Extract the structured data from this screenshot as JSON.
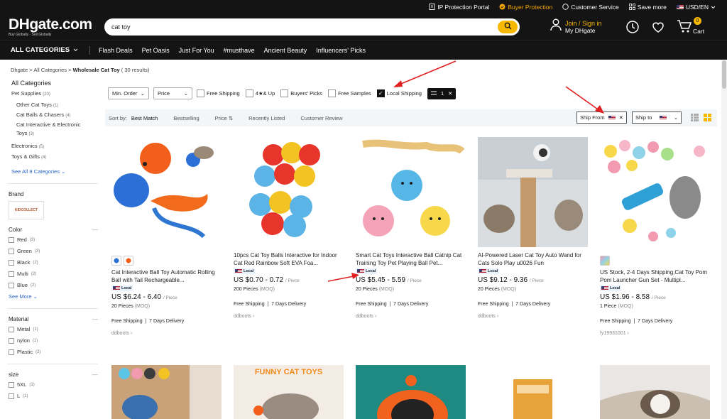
{
  "topbar": {
    "ip": "IP Protection Portal",
    "buyer": "Buyer Protection",
    "service": "Customer Service",
    "save": "Save more",
    "lang": "USD/EN"
  },
  "header": {
    "logo": "DHgate.com",
    "logo_tagline": "Buy Globally · Sell Globally",
    "search_value": "cat toy",
    "join": "Join / Sign in",
    "my": "My DHgate",
    "cart_count": "0",
    "cart": "Cart"
  },
  "nav": {
    "all_categories": "ALL CATEGORIES",
    "items": [
      "Flash Deals",
      "Pet Oasis",
      "Just For You",
      "#musthave",
      "Ancient Beauty",
      "Influencers' Picks"
    ]
  },
  "breadcrumb": {
    "a": "Dhgate",
    "sep1": " > ",
    "b": "All Categories",
    "sep2": " > ",
    "c": "Wholesale Cat Toy",
    "count_prefix": " ( ",
    "count": "30",
    "count_suffix": "  results)"
  },
  "sidebar": {
    "all_categories": "All Categories",
    "pet_supplies": "Pet Supplies",
    "pet_supplies_count": "(20)",
    "other_cat_toys": "Other Cat Toys",
    "other_cat_toys_count": "(1)",
    "cat_balls": "Cat Balls & Chasers",
    "cat_balls_count": "(4)",
    "cat_interactive": "Cat Interactive & Electronic Toys",
    "cat_interactive_count": "(3)",
    "electronics": "Electronics",
    "electronics_count": "(5)",
    "toys_gifts": "Toys & Gifts",
    "toys_gifts_count": "(4)",
    "see_all": "See All 8 Categories",
    "brand": "Brand",
    "brand_logo": "KIDCOLLECT",
    "color": "Color",
    "colors": [
      {
        "label": "Red",
        "count": "(3)"
      },
      {
        "label": "Green",
        "count": "(3)"
      },
      {
        "label": "Black",
        "count": "(2)"
      },
      {
        "label": "Multi",
        "count": "(2)"
      },
      {
        "label": "Blue",
        "count": "(2)"
      }
    ],
    "see_more": "See More",
    "material": "Material",
    "materials": [
      {
        "label": "Metal",
        "count": "(1)"
      },
      {
        "label": "nylon",
        "count": "(1)"
      },
      {
        "label": "Plastic",
        "count": "(2)"
      }
    ],
    "size": "size",
    "sizes": [
      {
        "label": "5XL",
        "count": "(1)"
      },
      {
        "label": "L",
        "count": "(1)"
      }
    ]
  },
  "filters": {
    "min_order": "Min. Order",
    "price": "Price",
    "free_shipping": "Free Shipping",
    "star_up": "4★& Up",
    "buyers_picks": "Buyers' Picks",
    "free_samples": "Free Samples",
    "local_shipping": "Local Shipping",
    "local_shipping_checked": true,
    "chip_count": "1"
  },
  "sort": {
    "label": "Sort by:",
    "best": "Best Match",
    "bestselling": "Bestselling",
    "price": "Price ⇅",
    "recent": "Recently Listed",
    "review": "Customer Review",
    "ship_from": "Ship From",
    "ship_to": "Ship to"
  },
  "products": [
    {
      "title": "Cat Interactive Ball Toy Automatic Rolling Ball with Tail Rechargeable...",
      "badge": "Local",
      "price": "US $6.24 - 6.40",
      "unit": "/ Piece",
      "moq": "20 Pieces",
      "moq_label": "(MOQ)",
      "ship": "Free Shipping  |  7 Days Delivery",
      "store": "ddboots"
    },
    {
      "title": "10pcs Cat Toy Balls Interactive for Indoor Cat Red Rainbow Soft EVA Foa...",
      "badge": "Local",
      "price": "US $0.70 - 0.72",
      "unit": "/ Piece",
      "moq": "200 Pieces",
      "moq_label": "(MOQ)",
      "ship": "Free Shipping  |  7 Days Delivery",
      "store": "ddboots"
    },
    {
      "title": "Smart Cat Toys Interactive Ball Catnip Cat Training Toy Pet Playing Ball Pet...",
      "badge": "Local",
      "price": "US $5.45 - 5.59",
      "unit": "/ Piece",
      "moq": "20 Pieces",
      "moq_label": "(MOQ)",
      "ship": "Free Shipping  |  7 Days Delivery",
      "store": "ddboots"
    },
    {
      "title": "AI-Powered Laser Cat Toy Auto Wand for Cats Solo Play u0026 Fun",
      "badge": "Local",
      "price": "US $9.12 - 9.36",
      "unit": "/ Piece",
      "moq": "20 Pieces",
      "moq_label": "(MOQ)",
      "ship": "Free Shipping  |  7 Days Delivery",
      "store": "ddboots"
    },
    {
      "title": "US Stock, 2-4 Days Shipping,Cat Toy Pom Pom Launcher Gun Set - Multipl...",
      "badge": "Local",
      "price": "US $1.96 - 8.58",
      "unit": "/ Piece",
      "moq": "1 Piece",
      "moq_label": "(MOQ)",
      "ship": "Free Shipping  |  7 Days Delivery",
      "store": "fy19931001"
    }
  ],
  "row2_banner": "FUNNY CAT TOYS",
  "colors": {
    "accent": "#f7b900",
    "dark": "#141414",
    "link": "#2a66c8",
    "arrow": "#e02020"
  }
}
